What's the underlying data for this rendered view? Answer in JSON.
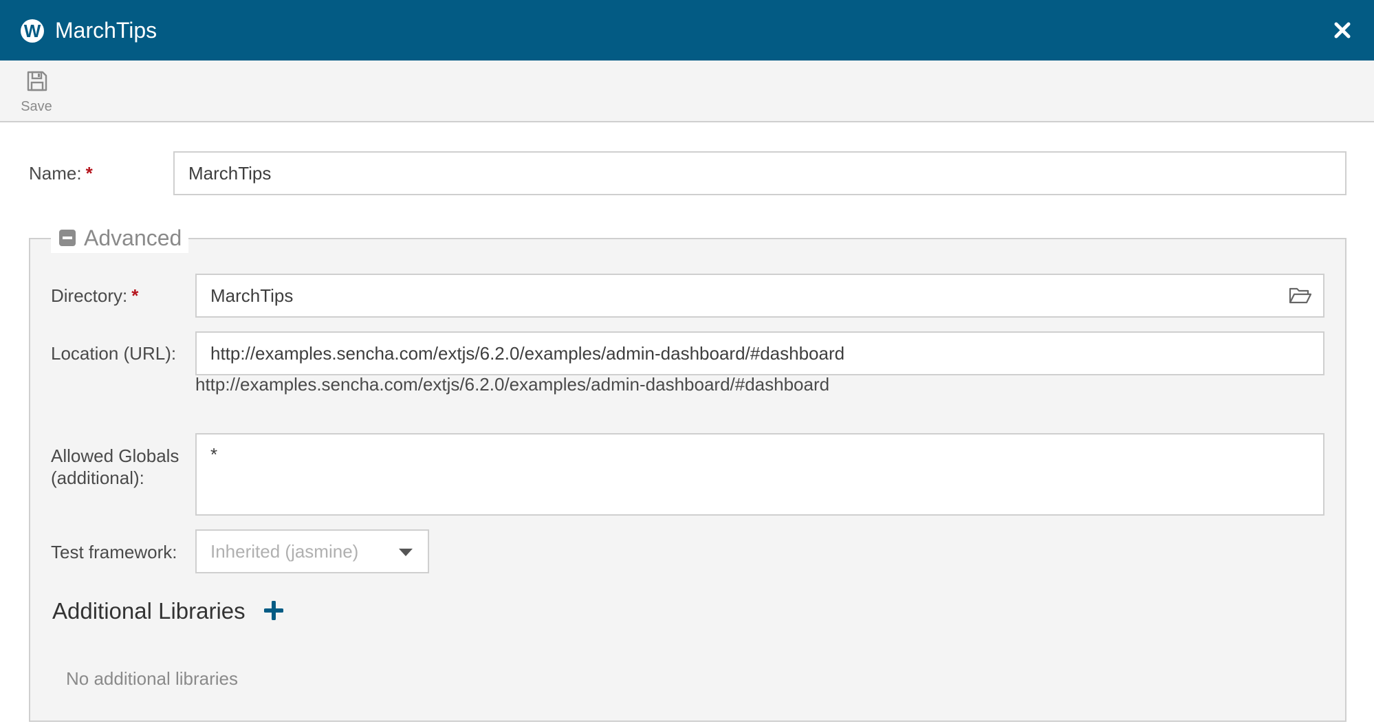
{
  "window": {
    "title": "MarchTips",
    "logo_letter": "W",
    "accent_color": "#035b84"
  },
  "toolbar": {
    "save_label": "Save"
  },
  "form": {
    "name": {
      "label": "Name:",
      "required_mark": "*",
      "value": "MarchTips"
    },
    "advanced": {
      "legend": "Advanced",
      "directory": {
        "label": "Directory:",
        "required_mark": "*",
        "value": "MarchTips"
      },
      "location": {
        "label": "Location (URL):",
        "value": "http://examples.sencha.com/extjs/6.2.0/examples/admin-dashboard/#dashboard",
        "display": "http://examples.sencha.com/extjs/6.2.0/examples/admin-dashboard/#dashboard"
      },
      "allowed_globals": {
        "label_line1": "Allowed Globals",
        "label_line2": "(additional):",
        "value": "*"
      },
      "test_framework": {
        "label": "Test framework:",
        "selected": "Inherited (jasmine)"
      },
      "additional_libraries": {
        "heading": "Additional Libraries",
        "empty_text": "No additional libraries"
      }
    }
  },
  "icons": {
    "close": "close-icon",
    "save": "save-icon",
    "folder": "folder-open-icon",
    "collapse": "minus-square-icon",
    "add": "plus-icon",
    "dropdown": "chevron-down-icon"
  }
}
